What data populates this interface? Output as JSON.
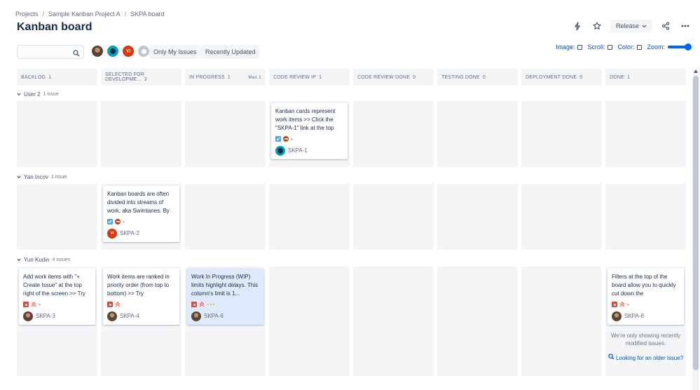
{
  "breadcrumb": [
    "Projects",
    "Sample Kanban Project A",
    "SKPA board"
  ],
  "page_title": "Kanban board",
  "header": {
    "release_label": "Release"
  },
  "toolbar": {
    "search_placeholder": "",
    "avatar_initials_yi": "YI",
    "only_my_issues": "Only My Issues",
    "recently_updated": "Recently Updated",
    "image_label": "Image:",
    "scroll_label": "Scroll:",
    "color_label": "Color:",
    "zoom_label": "Zoom:"
  },
  "columns": [
    {
      "name": "BACKLOG",
      "count": "1",
      "max": ""
    },
    {
      "name": "SELECTED FOR DEVELOPME...",
      "count": "2",
      "max": ""
    },
    {
      "name": "IN PROGRESS",
      "count": "1",
      "max": "Max 1"
    },
    {
      "name": "CODE REVIEW IP",
      "count": "1",
      "max": ""
    },
    {
      "name": "CODE REVIEW DONE",
      "count": "0",
      "max": ""
    },
    {
      "name": "TESTING DONE",
      "count": "0",
      "max": ""
    },
    {
      "name": "DEPLOYMENT DONE",
      "count": "0",
      "max": ""
    },
    {
      "name": "DONE",
      "count": "1",
      "max": ""
    }
  ],
  "lanes": [
    {
      "name": "User 2",
      "count": "1 issue"
    },
    {
      "name": "Yan Incov",
      "count": "1 issue"
    },
    {
      "name": "Yuri Kudin",
      "count": "4 issues"
    }
  ],
  "cards": {
    "skpa1": {
      "summary": "Kanban cards represent work items >> Click the \"SKPA-1\" link at the top",
      "key": "SKPA-1"
    },
    "skpa2": {
      "summary": "Kanban boards are often divided into streams of work, aka Swimlanes. By",
      "key": "SKPA-2",
      "initials": "YI"
    },
    "skpa3": {
      "summary": "Add work items with \"+ Create Issue\" at the top right of the screen >> Try",
      "key": "SKPA-3"
    },
    "skpa4": {
      "summary": "Work items are ranked in priority order (from top to bottom) >> Try",
      "key": "SKPA-4"
    },
    "skpa6": {
      "summary": "Work In Progress (WIP) limits highlight delays. This column's limit is 1...",
      "key": "SKPA-6"
    },
    "skpa8": {
      "summary": "Filters at the top of the board allow you to quickly cut down the",
      "key": "SKPA-8"
    }
  },
  "done_note": "We're only showing recently modified issues.",
  "done_link": "Looking for an older issue?",
  "colors": {
    "accent": "#0052cc",
    "column_bg": "#f4f5f7",
    "wip_highlight": "#deebff"
  }
}
